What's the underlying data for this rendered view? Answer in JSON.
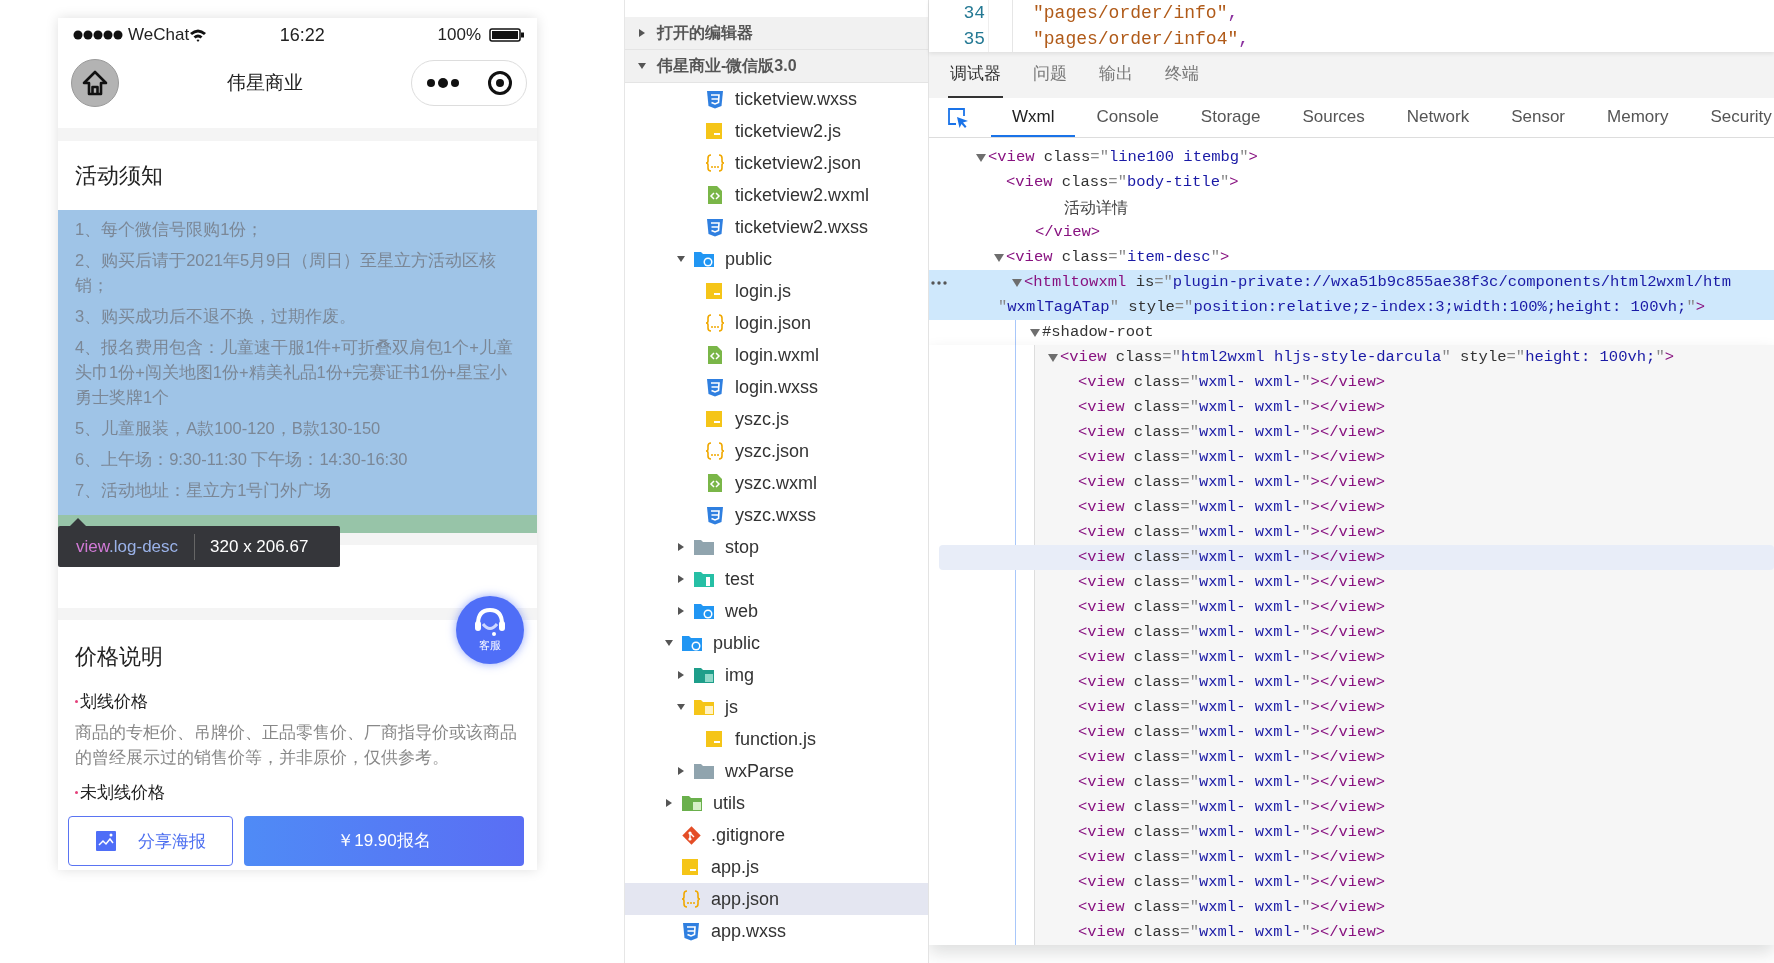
{
  "phone": {
    "status_bar": {
      "carrier": "WeChat",
      "time": "16:22",
      "battery": "100%"
    },
    "nav": {
      "title": "伟星商业"
    },
    "notice": {
      "title": "活动须知",
      "highlighted": true,
      "items": [
        "1、每个微信号限购1份；",
        "2、购买后请于2021年5月9日（周日）至星立方活动区核销；",
        "3、购买成功后不退不换，过期作废。",
        "4、报名费用包含：儿童速干服1件+可折叠双肩包1个+儿童头巾1份+闯关地图1份+精美礼品1份+完赛证书1份+星宝小勇士奖牌1个",
        "5、儿童服装，A款100-120，B款130-150",
        "6、上午场：9:30-11:30 下午场：14:30-16:30",
        "7、活动地址：星立方1号门外广场"
      ]
    },
    "inspector_tooltip": {
      "tag": "view",
      "class_name": ".log-desc",
      "size": "320 x 206.67"
    },
    "price": {
      "title": "价格说明",
      "items": [
        {
          "title": "划线价格",
          "text": "商品的专柜价、吊牌价、正品零售价、厂商指导价或该商品的曾经展示过的销售价等，并非原价，仅供参考。"
        },
        {
          "title": "未划线价格"
        }
      ]
    },
    "service_button": {
      "label": "客服"
    },
    "actions": [
      {
        "kind": "share",
        "label": "分享海报"
      },
      {
        "kind": "signup",
        "label": "￥19.90报名"
      }
    ]
  },
  "sidebar": {
    "sections": [
      {
        "title": "打开的编辑器",
        "expanded": false
      },
      {
        "title": "伟星商业-微信版3.0",
        "expanded": true
      }
    ],
    "tree": [
      {
        "children": [
          {
            "children": [
              {
                "name": "ticketview.wxss",
                "kind": "wxss",
                "selected": false
              },
              {
                "name": "ticketview2.js",
                "kind": "js",
                "selected": false
              },
              {
                "name": "ticketview2.json",
                "kind": "json",
                "selected": false
              },
              {
                "name": "ticketview2.wxml",
                "kind": "wxml",
                "selected": false
              },
              {
                "name": "ticketview2.wxss",
                "kind": "wxss",
                "selected": false
              }
            ]
          },
          {
            "name": "public",
            "kind": "folder-web",
            "expanded": true,
            "selected": false,
            "children": [
              {
                "name": "login.js",
                "kind": "js",
                "selected": false
              },
              {
                "name": "login.json",
                "kind": "json",
                "selected": false
              },
              {
                "name": "login.wxml",
                "kind": "wxml",
                "selected": false
              },
              {
                "name": "login.wxss",
                "kind": "wxss",
                "selected": false
              },
              {
                "name": "yszc.js",
                "kind": "js",
                "selected": false
              },
              {
                "name": "yszc.json",
                "kind": "json",
                "selected": false
              },
              {
                "name": "yszc.wxml",
                "kind": "wxml",
                "selected": false
              },
              {
                "name": "yszc.wxss",
                "kind": "wxss",
                "selected": false
              }
            ]
          },
          {
            "name": "stop",
            "kind": "folder",
            "expanded": false,
            "selected": false
          },
          {
            "name": "test",
            "kind": "folder-test",
            "expanded": false,
            "selected": false
          },
          {
            "name": "web",
            "kind": "folder-web",
            "expanded": false,
            "selected": false
          }
        ]
      },
      {
        "name": "public",
        "kind": "folder-web",
        "expanded": true,
        "selected": false,
        "children": [
          {
            "name": "img",
            "kind": "folder-img",
            "expanded": false,
            "selected": false
          },
          {
            "name": "js",
            "kind": "folder-js",
            "expanded": true,
            "selected": false,
            "children": [
              {
                "name": "function.js",
                "kind": "js",
                "selected": false
              }
            ]
          },
          {
            "name": "wxParse",
            "kind": "folder",
            "expanded": false,
            "selected": false
          }
        ]
      },
      {
        "name": "utils",
        "kind": "folder-utils",
        "expanded": false,
        "selected": false
      },
      {
        "name": ".gitignore",
        "kind": "git",
        "selected": false
      },
      {
        "name": "app.js",
        "kind": "js",
        "selected": false
      },
      {
        "name": "app.json",
        "kind": "json",
        "selected": true
      },
      {
        "name": "app.wxss",
        "kind": "wxss",
        "selected": false
      }
    ]
  },
  "editor": {
    "lines": [
      {
        "number": "34",
        "text": "\"pages/order/info\","
      },
      {
        "number": "35",
        "text": "\"pages/order/info4\","
      }
    ]
  },
  "panel_tabs": [
    {
      "label": "调试器",
      "selected": true
    },
    {
      "label": "问题",
      "selected": false
    },
    {
      "label": "输出",
      "selected": false
    },
    {
      "label": "终端",
      "selected": false
    }
  ],
  "devtools": {
    "inspect_active": true,
    "tabs": [
      {
        "label": "Wxml",
        "selected": true
      },
      {
        "label": "Console",
        "selected": false
      },
      {
        "label": "Storage",
        "selected": false
      },
      {
        "label": "Sources",
        "selected": false
      },
      {
        "label": "Network",
        "selected": false
      },
      {
        "label": "Sensor",
        "selected": false
      },
      {
        "label": "Memory",
        "selected": false
      },
      {
        "label": "Security",
        "selected": false
      }
    ],
    "elements": [
      {
        "text": "<view class=\"line100 itembg\">",
        "expanded": true,
        "selected": false,
        "children": [
          {
            "text": "<view class=\"body-title\">",
            "selected": false,
            "close": "</view>",
            "children": [
              {
                "kind": "text",
                "text": "活动详情",
                "selected": false
              }
            ]
          },
          {
            "text": "<view class=\"item-desc\">",
            "expanded": true,
            "selected": false,
            "children": [
              {
                "lines": [
                  "<htmltowxml is=\"plugin-private://wxa51b9c855ae38f3c/components/html2wxml/htm",
                  "\"wxmlTagATap\" style=\"position:relative;z-index:3;width:100%;height: 100vh;\">"
                ],
                "expanded": true,
                "selected": true,
                "children": [
                  {
                    "kind": "shadow-root",
                    "text": "#shadow-root",
                    "expanded": true,
                    "selected": false,
                    "children": [
                      {
                        "text": "<view class=\"html2wxml hljs-style-darcula\" style=\"height: 100vh;\">",
                        "expanded": true,
                        "selected": false,
                        "children": [
                          {
                            "text": "<view class=\"wxml- wxml-\"></view>",
                            "selected": false,
                            "hovered": false
                          },
                          {
                            "text": "<view class=\"wxml- wxml-\"></view>",
                            "selected": false,
                            "hovered": false
                          },
                          {
                            "text": "<view class=\"wxml- wxml-\"></view>",
                            "selected": false,
                            "hovered": false
                          },
                          {
                            "text": "<view class=\"wxml- wxml-\"></view>",
                            "selected": false,
                            "hovered": false
                          },
                          {
                            "text": "<view class=\"wxml- wxml-\"></view>",
                            "selected": false,
                            "hovered": false
                          },
                          {
                            "text": "<view class=\"wxml- wxml-\"></view>",
                            "selected": false,
                            "hovered": false
                          },
                          {
                            "text": "<view class=\"wxml- wxml-\"></view>",
                            "selected": false,
                            "hovered": false
                          },
                          {
                            "text": "<view class=\"wxml- wxml-\"></view>",
                            "selected": false,
                            "hovered": true
                          },
                          {
                            "text": "<view class=\"wxml- wxml-\"></view>",
                            "selected": false,
                            "hovered": false
                          },
                          {
                            "text": "<view class=\"wxml- wxml-\"></view>",
                            "selected": false,
                            "hovered": false
                          },
                          {
                            "text": "<view class=\"wxml- wxml-\"></view>",
                            "selected": false,
                            "hovered": false
                          },
                          {
                            "text": "<view class=\"wxml- wxml-\"></view>",
                            "selected": false,
                            "hovered": false
                          },
                          {
                            "text": "<view class=\"wxml- wxml-\"></view>",
                            "selected": false,
                            "hovered": false
                          },
                          {
                            "text": "<view class=\"wxml- wxml-\"></view>",
                            "selected": false,
                            "hovered": false
                          },
                          {
                            "text": "<view class=\"wxml- wxml-\"></view>",
                            "selected": false,
                            "hovered": false
                          },
                          {
                            "text": "<view class=\"wxml- wxml-\"></view>",
                            "selected": false,
                            "hovered": false
                          },
                          {
                            "text": "<view class=\"wxml- wxml-\"></view>",
                            "selected": false,
                            "hovered": false
                          },
                          {
                            "text": "<view class=\"wxml- wxml-\"></view>",
                            "selected": false,
                            "hovered": false
                          },
                          {
                            "text": "<view class=\"wxml- wxml-\"></view>",
                            "selected": false,
                            "hovered": false
                          },
                          {
                            "text": "<view class=\"wxml- wxml-\"></view>",
                            "selected": false,
                            "hovered": false
                          },
                          {
                            "text": "<view class=\"wxml- wxml-\"></view>",
                            "selected": false,
                            "hovered": false
                          },
                          {
                            "text": "<view class=\"wxml- wxml-\"></view>",
                            "selected": false,
                            "hovered": false
                          },
                          {
                            "text": "<view class=\"wxml- wxml-\"></view>",
                            "selected": false,
                            "hovered": false
                          }
                        ]
                      }
                    ]
                  }
                ]
              }
            ]
          }
        ]
      }
    ]
  }
}
